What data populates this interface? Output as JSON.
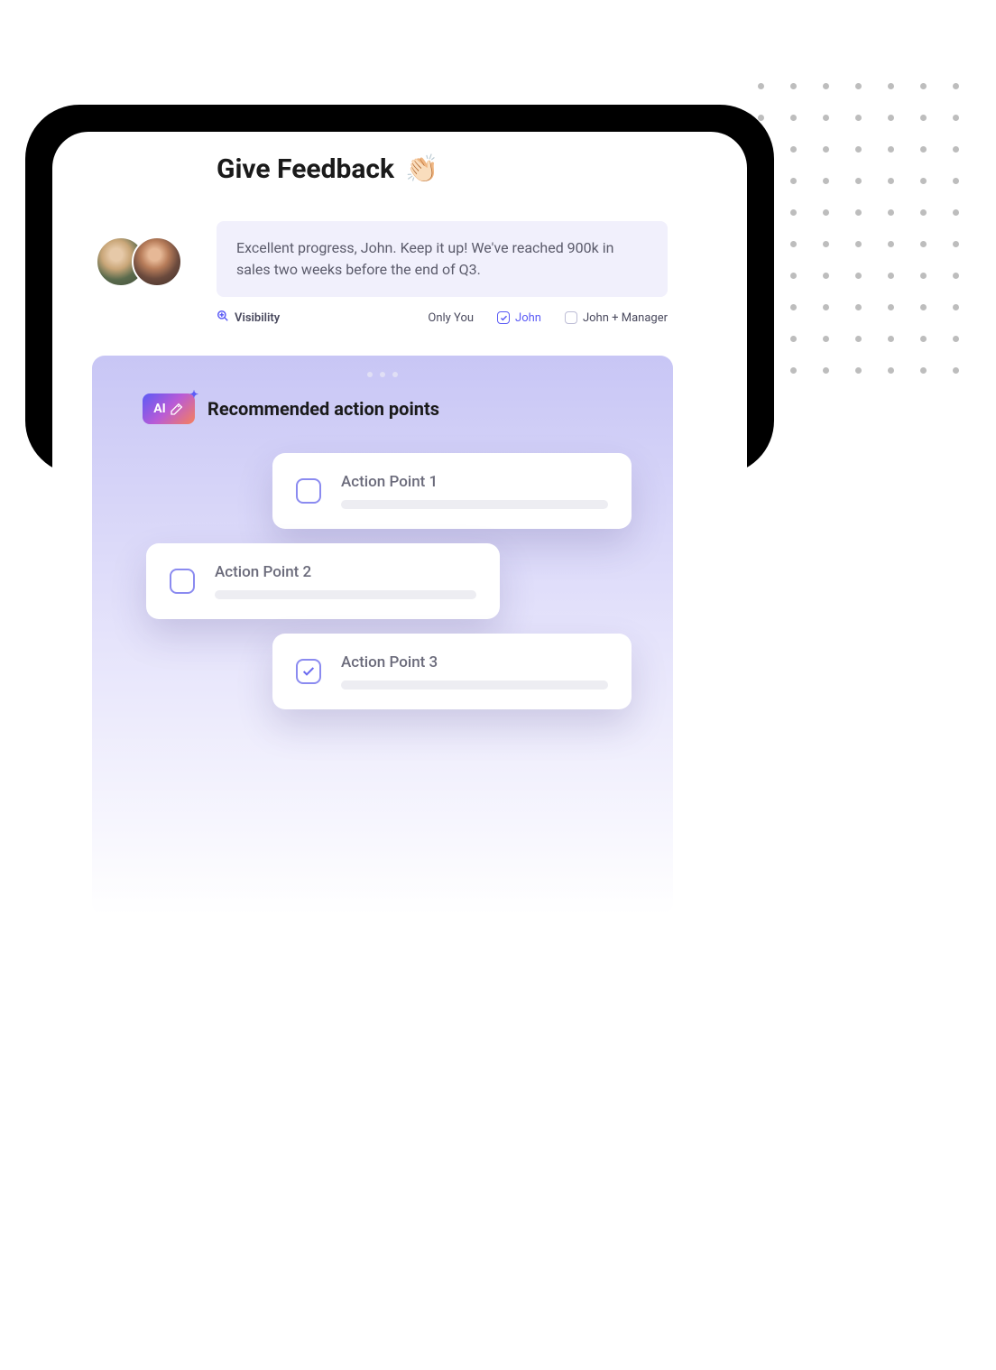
{
  "header": {
    "title": "Give Feedback",
    "emoji": "👏🏻"
  },
  "feedback": {
    "text": "Excellent progress, John. Keep it up! We've reached 900k in sales two weeks before the end of Q3."
  },
  "visibility": {
    "label": "Visibility",
    "options": [
      {
        "label": "Only You",
        "checked": false
      },
      {
        "label": "John",
        "checked": true
      },
      {
        "label": "John + Manager",
        "checked": false
      }
    ]
  },
  "ai_badge": {
    "label": "AI"
  },
  "recommendations": {
    "title": "Recommended action points",
    "items": [
      {
        "label": "Action Point 1",
        "checked": false
      },
      {
        "label": "Action Point 2",
        "checked": false
      },
      {
        "label": "Action Point 3",
        "checked": true
      }
    ]
  }
}
